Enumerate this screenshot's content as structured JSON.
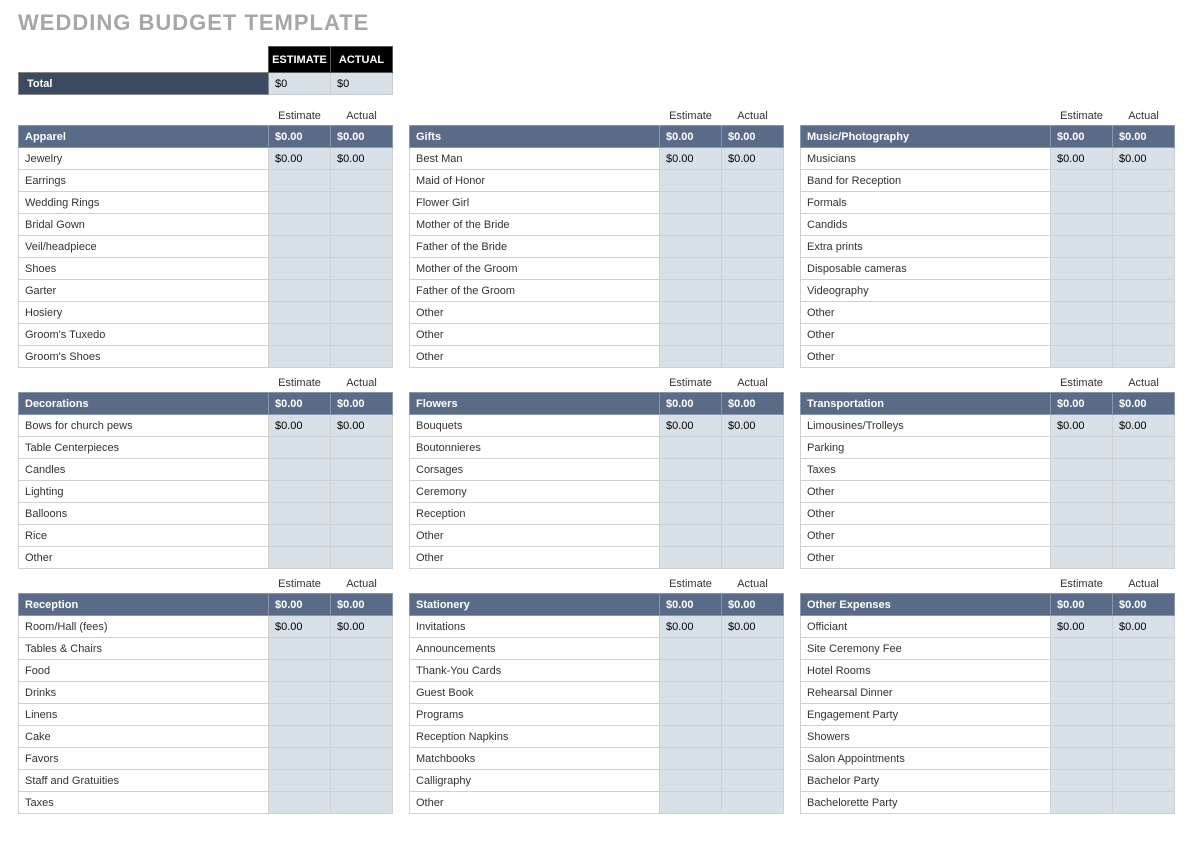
{
  "title": "WEDDING BUDGET TEMPLATE",
  "top": {
    "estimate_hdr": "ESTIMATE",
    "actual_hdr": "ACTUAL",
    "total_label": "Total",
    "total_estimate": "$0",
    "total_actual": "$0"
  },
  "col_labels": {
    "estimate": "Estimate",
    "actual": "Actual"
  },
  "categories": [
    {
      "name": "Apparel",
      "estimate": "$0.00",
      "actual": "$0.00",
      "rows": [
        {
          "label": "Jewelry",
          "estimate": "$0.00",
          "actual": "$0.00"
        },
        {
          "label": "Earrings",
          "estimate": "",
          "actual": ""
        },
        {
          "label": "Wedding Rings",
          "estimate": "",
          "actual": ""
        },
        {
          "label": "Bridal Gown",
          "estimate": "",
          "actual": ""
        },
        {
          "label": "Veil/headpiece",
          "estimate": "",
          "actual": ""
        },
        {
          "label": "Shoes",
          "estimate": "",
          "actual": ""
        },
        {
          "label": "Garter",
          "estimate": "",
          "actual": ""
        },
        {
          "label": "Hosiery",
          "estimate": "",
          "actual": ""
        },
        {
          "label": "Groom's Tuxedo",
          "estimate": "",
          "actual": ""
        },
        {
          "label": "Groom's Shoes",
          "estimate": "",
          "actual": ""
        }
      ]
    },
    {
      "name": "Gifts",
      "estimate": "$0.00",
      "actual": "$0.00",
      "rows": [
        {
          "label": "Best Man",
          "estimate": "$0.00",
          "actual": "$0.00"
        },
        {
          "label": "Maid of Honor",
          "estimate": "",
          "actual": ""
        },
        {
          "label": "Flower Girl",
          "estimate": "",
          "actual": ""
        },
        {
          "label": "Mother of the Bride",
          "estimate": "",
          "actual": ""
        },
        {
          "label": "Father of the Bride",
          "estimate": "",
          "actual": ""
        },
        {
          "label": "Mother of the Groom",
          "estimate": "",
          "actual": ""
        },
        {
          "label": "Father of the Groom",
          "estimate": "",
          "actual": ""
        },
        {
          "label": "Other",
          "estimate": "",
          "actual": ""
        },
        {
          "label": "Other",
          "estimate": "",
          "actual": ""
        },
        {
          "label": "Other",
          "estimate": "",
          "actual": ""
        }
      ]
    },
    {
      "name": "Music/Photography",
      "estimate": "$0.00",
      "actual": "$0.00",
      "rows": [
        {
          "label": "Musicians",
          "estimate": "$0.00",
          "actual": "$0.00"
        },
        {
          "label": "Band for Reception",
          "estimate": "",
          "actual": ""
        },
        {
          "label": "Formals",
          "estimate": "",
          "actual": ""
        },
        {
          "label": "Candids",
          "estimate": "",
          "actual": ""
        },
        {
          "label": "Extra prints",
          "estimate": "",
          "actual": ""
        },
        {
          "label": "Disposable cameras",
          "estimate": "",
          "actual": ""
        },
        {
          "label": "Videography",
          "estimate": "",
          "actual": ""
        },
        {
          "label": "Other",
          "estimate": "",
          "actual": ""
        },
        {
          "label": "Other",
          "estimate": "",
          "actual": ""
        },
        {
          "label": "Other",
          "estimate": "",
          "actual": ""
        }
      ]
    },
    {
      "name": "Decorations",
      "estimate": "$0.00",
      "actual": "$0.00",
      "rows": [
        {
          "label": "Bows for church pews",
          "estimate": "$0.00",
          "actual": "$0.00"
        },
        {
          "label": "Table Centerpieces",
          "estimate": "",
          "actual": ""
        },
        {
          "label": "Candles",
          "estimate": "",
          "actual": ""
        },
        {
          "label": "Lighting",
          "estimate": "",
          "actual": ""
        },
        {
          "label": "Balloons",
          "estimate": "",
          "actual": ""
        },
        {
          "label": "Rice",
          "estimate": "",
          "actual": ""
        },
        {
          "label": "Other",
          "estimate": "",
          "actual": ""
        }
      ]
    },
    {
      "name": "Flowers",
      "estimate": "$0.00",
      "actual": "$0.00",
      "rows": [
        {
          "label": "Bouquets",
          "estimate": "$0.00",
          "actual": "$0.00"
        },
        {
          "label": "Boutonnieres",
          "estimate": "",
          "actual": ""
        },
        {
          "label": "Corsages",
          "estimate": "",
          "actual": ""
        },
        {
          "label": "Ceremony",
          "estimate": "",
          "actual": ""
        },
        {
          "label": "Reception",
          "estimate": "",
          "actual": ""
        },
        {
          "label": "Other",
          "estimate": "",
          "actual": ""
        },
        {
          "label": "Other",
          "estimate": "",
          "actual": ""
        }
      ]
    },
    {
      "name": "Transportation",
      "estimate": "$0.00",
      "actual": "$0.00",
      "rows": [
        {
          "label": "Limousines/Trolleys",
          "estimate": "$0.00",
          "actual": "$0.00"
        },
        {
          "label": "Parking",
          "estimate": "",
          "actual": ""
        },
        {
          "label": "Taxes",
          "estimate": "",
          "actual": ""
        },
        {
          "label": "Other",
          "estimate": "",
          "actual": ""
        },
        {
          "label": "Other",
          "estimate": "",
          "actual": ""
        },
        {
          "label": "Other",
          "estimate": "",
          "actual": ""
        },
        {
          "label": "Other",
          "estimate": "",
          "actual": ""
        }
      ]
    },
    {
      "name": "Reception",
      "estimate": "$0.00",
      "actual": "$0.00",
      "rows": [
        {
          "label": "Room/Hall (fees)",
          "estimate": "$0.00",
          "actual": "$0.00"
        },
        {
          "label": "Tables & Chairs",
          "estimate": "",
          "actual": ""
        },
        {
          "label": "Food",
          "estimate": "",
          "actual": ""
        },
        {
          "label": "Drinks",
          "estimate": "",
          "actual": ""
        },
        {
          "label": "Linens",
          "estimate": "",
          "actual": ""
        },
        {
          "label": "Cake",
          "estimate": "",
          "actual": ""
        },
        {
          "label": "Favors",
          "estimate": "",
          "actual": ""
        },
        {
          "label": "Staff and Gratuities",
          "estimate": "",
          "actual": ""
        },
        {
          "label": "Taxes",
          "estimate": "",
          "actual": ""
        }
      ]
    },
    {
      "name": "Stationery",
      "estimate": "$0.00",
      "actual": "$0.00",
      "rows": [
        {
          "label": "Invitations",
          "estimate": "$0.00",
          "actual": "$0.00"
        },
        {
          "label": "Announcements",
          "estimate": "",
          "actual": ""
        },
        {
          "label": "Thank-You Cards",
          "estimate": "",
          "actual": ""
        },
        {
          "label": "Guest Book",
          "estimate": "",
          "actual": ""
        },
        {
          "label": "Programs",
          "estimate": "",
          "actual": ""
        },
        {
          "label": "Reception Napkins",
          "estimate": "",
          "actual": ""
        },
        {
          "label": "Matchbooks",
          "estimate": "",
          "actual": ""
        },
        {
          "label": "Calligraphy",
          "estimate": "",
          "actual": ""
        },
        {
          "label": "Other",
          "estimate": "",
          "actual": ""
        }
      ]
    },
    {
      "name": "Other Expenses",
      "estimate": "$0.00",
      "actual": "$0.00",
      "rows": [
        {
          "label": "Officiant",
          "estimate": "$0.00",
          "actual": "$0.00"
        },
        {
          "label": "Site Ceremony Fee",
          "estimate": "",
          "actual": ""
        },
        {
          "label": "Hotel Rooms",
          "estimate": "",
          "actual": ""
        },
        {
          "label": "Rehearsal Dinner",
          "estimate": "",
          "actual": ""
        },
        {
          "label": "Engagement Party",
          "estimate": "",
          "actual": ""
        },
        {
          "label": "Showers",
          "estimate": "",
          "actual": ""
        },
        {
          "label": "Salon Appointments",
          "estimate": "",
          "actual": ""
        },
        {
          "label": "Bachelor Party",
          "estimate": "",
          "actual": ""
        },
        {
          "label": "Bachelorette Party",
          "estimate": "",
          "actual": ""
        }
      ]
    }
  ]
}
